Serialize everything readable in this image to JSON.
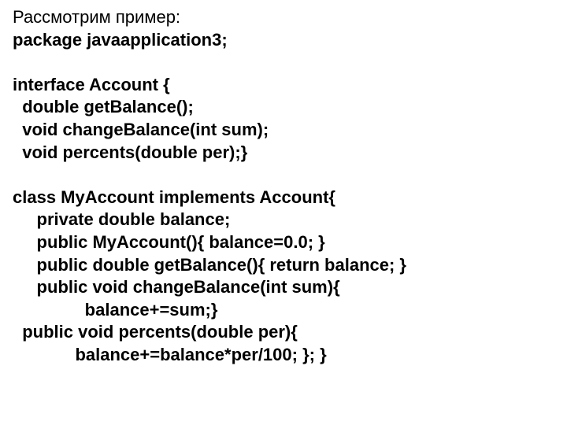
{
  "lines": [
    {
      "text": "Рассмотрим пример:",
      "weight": "plain"
    },
    {
      "text": "package javaapplication3;",
      "weight": "bold"
    },
    {
      "text": " ",
      "weight": "plain"
    },
    {
      "text": "interface Account {",
      "weight": "bold"
    },
    {
      "text": "  double getBalance();",
      "weight": "bold"
    },
    {
      "text": "  void changeBalance(int sum);",
      "weight": "bold"
    },
    {
      "text": "  void percents(double per);}",
      "weight": "bold"
    },
    {
      "text": " ",
      "weight": "plain"
    },
    {
      "text": "class MyAccount implements Account{",
      "weight": "bold"
    },
    {
      "text": "     private double balance;",
      "weight": "bold"
    },
    {
      "text": "     public MyAccount(){ balance=0.0; }",
      "weight": "bold"
    },
    {
      "text": "     public double getBalance(){ return balance; }",
      "weight": "bold"
    },
    {
      "text": "     public void changeBalance(int sum){",
      "weight": "bold"
    },
    {
      "text": "               balance+=sum;}",
      "weight": "bold"
    },
    {
      "text": "  public void percents(double per){",
      "weight": "bold"
    },
    {
      "text": "             balance+=balance*per/100; }; }",
      "weight": "bold"
    }
  ]
}
